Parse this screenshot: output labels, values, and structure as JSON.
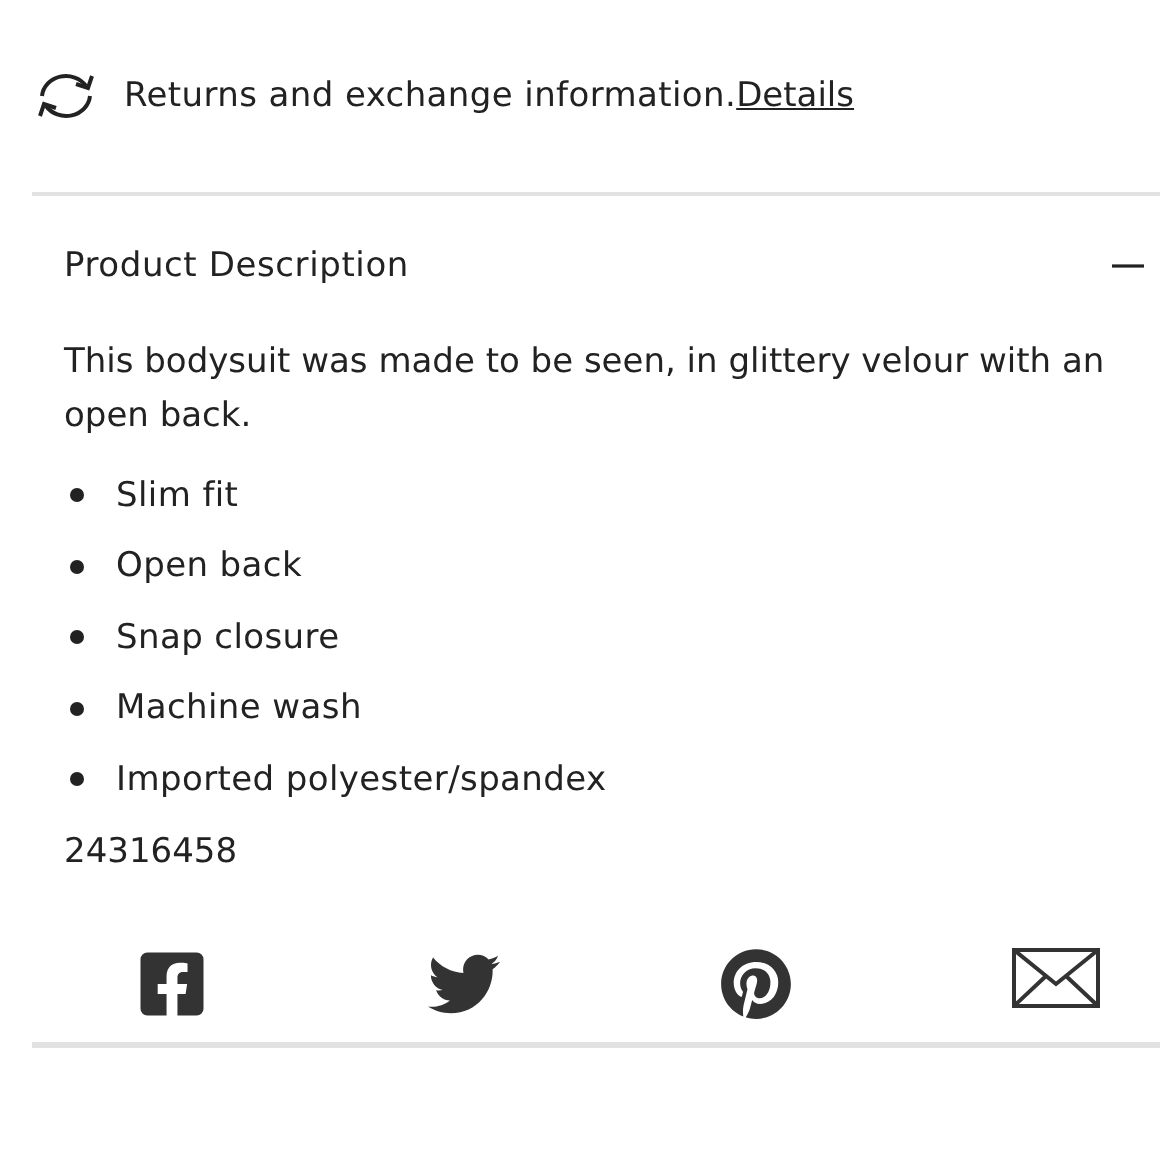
{
  "returns": {
    "text": "Returns and exchange information.",
    "link": "Details"
  },
  "section": {
    "title": "Product Description",
    "expanded": true,
    "description": "This bodysuit was made to be seen, in glittery velour with an open back.",
    "bullets": [
      "Slim fit",
      "Open back",
      "Snap closure",
      "Machine wash",
      "Imported polyester/spandex"
    ],
    "item_number": "24316458"
  },
  "share": [
    {
      "kind": "facebook"
    },
    {
      "kind": "twitter"
    },
    {
      "kind": "pinterest"
    },
    {
      "kind": "email"
    }
  ]
}
